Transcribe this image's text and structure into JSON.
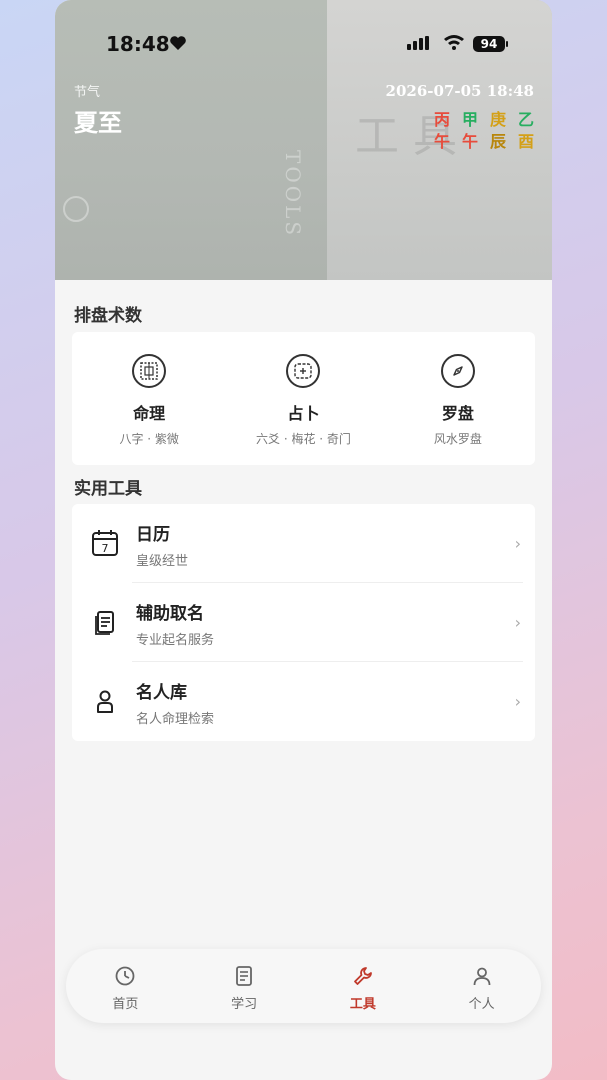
{
  "status": {
    "time": "18:48",
    "battery": "94"
  },
  "header": {
    "term_label": "节气",
    "term_name": "夏至",
    "datetime": "2026-07-05 18:48",
    "watermark": "工具",
    "vertical_text": "TOOLS",
    "ganzhi_top": [
      "丙",
      "甲",
      "庚",
      "乙"
    ],
    "ganzhi_bottom": [
      "午",
      "午",
      "辰",
      "酉"
    ],
    "ganzhi_top_colors": [
      "#e74c3c",
      "#27ae60",
      "#d4a017",
      "#27ae60"
    ],
    "ganzhi_bottom_colors": [
      "#e74c3c",
      "#e74c3c",
      "#b8860b",
      "#d4a017"
    ]
  },
  "divination": {
    "title": "排盘术数",
    "items": [
      {
        "name": "命理",
        "sub": "八字 · 紫微",
        "icon": "grid-chart-icon"
      },
      {
        "name": "占卜",
        "sub": "六爻 · 梅花 · 奇门",
        "icon": "hexagram-icon"
      },
      {
        "name": "罗盘",
        "sub": "风水罗盘",
        "icon": "compass-icon"
      }
    ]
  },
  "tools": {
    "title": "实用工具",
    "items": [
      {
        "title": "日历",
        "sub": "皇级经世",
        "icon": "calendar-icon"
      },
      {
        "title": "辅助取名",
        "sub": "专业起名服务",
        "icon": "document-icon"
      },
      {
        "title": "名人库",
        "sub": "名人命理检索",
        "icon": "person-icon"
      }
    ],
    "chevron": "›"
  },
  "tabbar": {
    "items": [
      {
        "label": "首页",
        "icon": "clock-icon",
        "active": false
      },
      {
        "label": "学习",
        "icon": "book-icon",
        "active": false
      },
      {
        "label": "工具",
        "icon": "wrench-icon",
        "active": true
      },
      {
        "label": "个人",
        "icon": "user-icon",
        "active": false
      }
    ],
    "active_color": "#c0392b"
  }
}
